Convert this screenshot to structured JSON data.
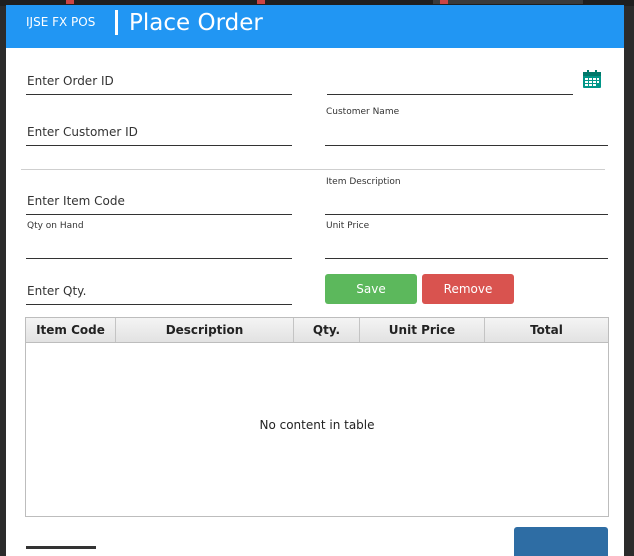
{
  "header": {
    "brand": "IJSE FX POS",
    "title": "Place Order"
  },
  "form": {
    "order_id_placeholder": "Enter Order ID",
    "customer_id_placeholder": "Enter Customer ID",
    "customer_name_label": "Customer Name",
    "item_code_placeholder": "Enter Item Code",
    "item_description_label": "Item Description",
    "qty_on_hand_label": "Qty on Hand",
    "unit_price_label": "Unit Price",
    "qty_placeholder": "Enter Qty."
  },
  "buttons": {
    "save": "Save",
    "remove": "Remove"
  },
  "table": {
    "columns": [
      "Item Code",
      "Description",
      "Qty.",
      "Unit Price",
      "Total"
    ],
    "empty_message": "No content in table"
  },
  "icons": {
    "date_picker": "calendar-icon"
  },
  "colors": {
    "header": "#2196f3",
    "save": "#5cb85c",
    "remove": "#d9534f",
    "place_order_button": "#2e6da4",
    "calendar_icon": "#009688"
  }
}
